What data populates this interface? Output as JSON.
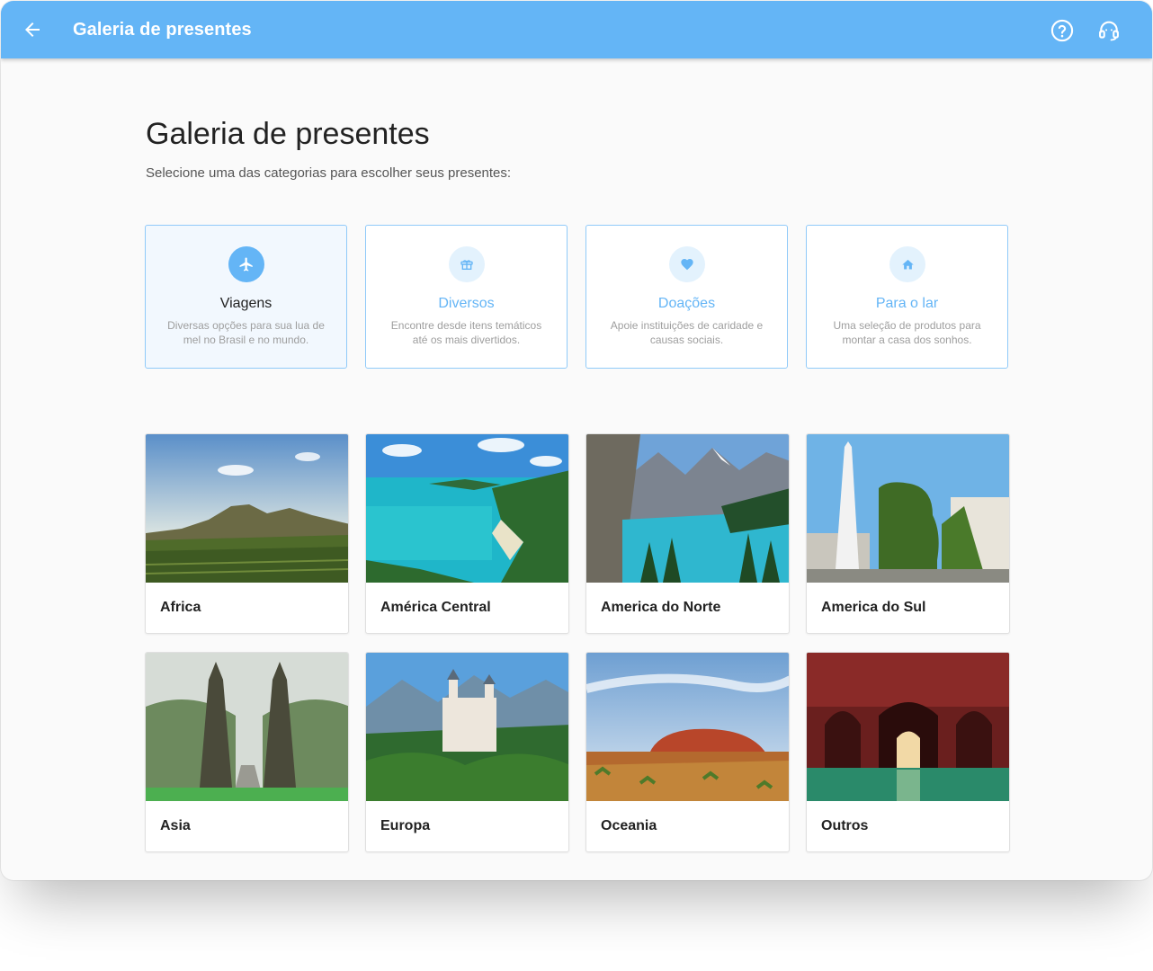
{
  "appbar": {
    "title": "Galeria de presentes",
    "color": "#64b5f6",
    "back_icon": "arrow-left-icon",
    "help_icon": "help-circle-icon",
    "support_icon": "headset-icon"
  },
  "page": {
    "title": "Galeria de presentes",
    "subtitle": "Selecione uma das categorias para escolher seus presentes:"
  },
  "categories": [
    {
      "label": "Viagens",
      "description": "Diversas opções para sua lua de mel no Brasil e no mundo.",
      "icon": "airplane-icon",
      "selected": true
    },
    {
      "label": "Diversos",
      "description": "Encontre desde itens temáticos até os mais divertidos.",
      "icon": "gift-icon",
      "selected": false
    },
    {
      "label": "Doações",
      "description": "Apoie instituições de caridade e causas sociais.",
      "icon": "heart-icon",
      "selected": false
    },
    {
      "label": "Para o lar",
      "description": "Uma seleção de produtos para montar a casa dos sonhos.",
      "icon": "home-icon",
      "selected": false
    }
  ],
  "destinations": [
    {
      "name": "Africa"
    },
    {
      "name": "América Central"
    },
    {
      "name": "America do Norte"
    },
    {
      "name": "America do Sul"
    },
    {
      "name": "Asia"
    },
    {
      "name": "Europa"
    },
    {
      "name": "Oceania"
    },
    {
      "name": "Outros"
    }
  ]
}
